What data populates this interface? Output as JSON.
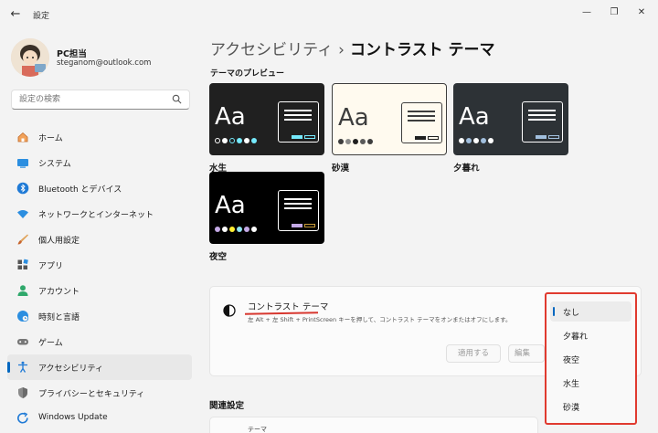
{
  "window": {
    "title": "設定",
    "back_icon": "←",
    "minimize_icon": "—",
    "maximize_icon": "❐",
    "close_icon": "✕"
  },
  "user": {
    "name": "PC担当",
    "email": "steganom@outlook.com"
  },
  "search": {
    "placeholder": "設定の検索"
  },
  "nav": {
    "items": [
      {
        "label": "ホーム",
        "icon": "home-icon"
      },
      {
        "label": "システム",
        "icon": "system-icon"
      },
      {
        "label": "Bluetooth とデバイス",
        "icon": "bluetooth-icon"
      },
      {
        "label": "ネットワークとインターネット",
        "icon": "wifi-icon"
      },
      {
        "label": "個人用設定",
        "icon": "brush-icon"
      },
      {
        "label": "アプリ",
        "icon": "apps-icon"
      },
      {
        "label": "アカウント",
        "icon": "account-icon"
      },
      {
        "label": "時刻と言語",
        "icon": "time-language-icon"
      },
      {
        "label": "ゲーム",
        "icon": "game-icon"
      },
      {
        "label": "アクセシビリティ",
        "icon": "accessibility-icon"
      },
      {
        "label": "プライバシーとセキュリティ",
        "icon": "shield-icon"
      },
      {
        "label": "Windows Update",
        "icon": "update-icon"
      }
    ],
    "active": "アクセシビリティ"
  },
  "breadcrumb": {
    "parent": "アクセシビリティ",
    "separator": "›",
    "current": "コントラスト テーマ"
  },
  "preview": {
    "title": "テーマのプレビュー",
    "sample_text": "Aa",
    "themes": [
      {
        "name": "水生",
        "bg": "#202020",
        "fg": "#ffffff",
        "accent": "#75e9fc"
      },
      {
        "name": "砂漠",
        "bg": "#fffaef",
        "fg": "#3d3d3d",
        "accent": "#202020"
      },
      {
        "name": "夕暮れ",
        "bg": "#2d3236",
        "fg": "#ffffff",
        "accent": "#a1bfde"
      },
      {
        "name": "夜空",
        "bg": "#000000",
        "fg": "#ffffff",
        "accent": "#c4a9e6"
      }
    ]
  },
  "contrast_card": {
    "title": "コントラスト テーマ",
    "description": "左 Alt + 左 Shift + PrintScreen キーを押して、コントラスト テーマをオンまたはオフにします。",
    "apply_label": "適用する",
    "edit_label": "編集"
  },
  "dropdown": {
    "options": [
      "なし",
      "夕暮れ",
      "夜空",
      "水生",
      "砂漠"
    ],
    "selected": "なし"
  },
  "related": {
    "title": "関連設定",
    "item": "テーマ"
  },
  "colors": {
    "accent": "#0067c0",
    "highlight": "#e03a2f"
  }
}
